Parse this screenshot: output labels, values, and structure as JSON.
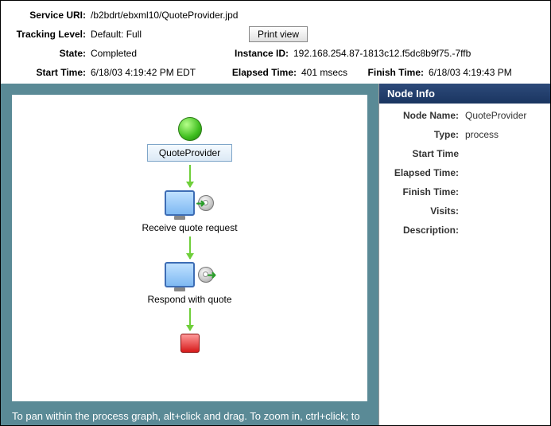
{
  "header": {
    "serviceUri": {
      "label": "Service URI:",
      "value": "/b2bdrt/ebxml10/QuoteProvider.jpd"
    },
    "trackingLevel": {
      "label": "Tracking Level:",
      "value": "Default: Full"
    },
    "printView": "Print view",
    "state": {
      "label": "State:",
      "value": "Completed"
    },
    "instanceId": {
      "label": "Instance ID:",
      "value": "192.168.254.87-1813c12.f5dc8b9f75.-7ffb"
    },
    "startTime": {
      "label": "Start Time:",
      "value": "6/18/03 4:19:42 PM EDT"
    },
    "elapsedTime": {
      "label": "Elapsed Time:",
      "value": "401 msecs"
    },
    "finishTime": {
      "label": "Finish Time:",
      "value": "6/18/03 4:19:43 PM"
    }
  },
  "flow": {
    "rootLabel": "QuoteProvider",
    "step1": "Receive quote request",
    "step2": "Respond with quote"
  },
  "hint": "To pan within the process graph, alt+click and drag. To zoom in, ctrl+click; to",
  "side": {
    "title": "Node Info",
    "nodeName": {
      "label": "Node Name:",
      "value": "QuoteProvider"
    },
    "type": {
      "label": "Type:",
      "value": "process"
    },
    "startTime": {
      "label": "Start Time",
      "value": ""
    },
    "elapsedTime": {
      "label": "Elapsed Time:",
      "value": ""
    },
    "finishTime": {
      "label": "Finish Time:",
      "value": ""
    },
    "visits": {
      "label": "Visits:",
      "value": ""
    },
    "description": {
      "label": "Description:",
      "value": ""
    }
  }
}
